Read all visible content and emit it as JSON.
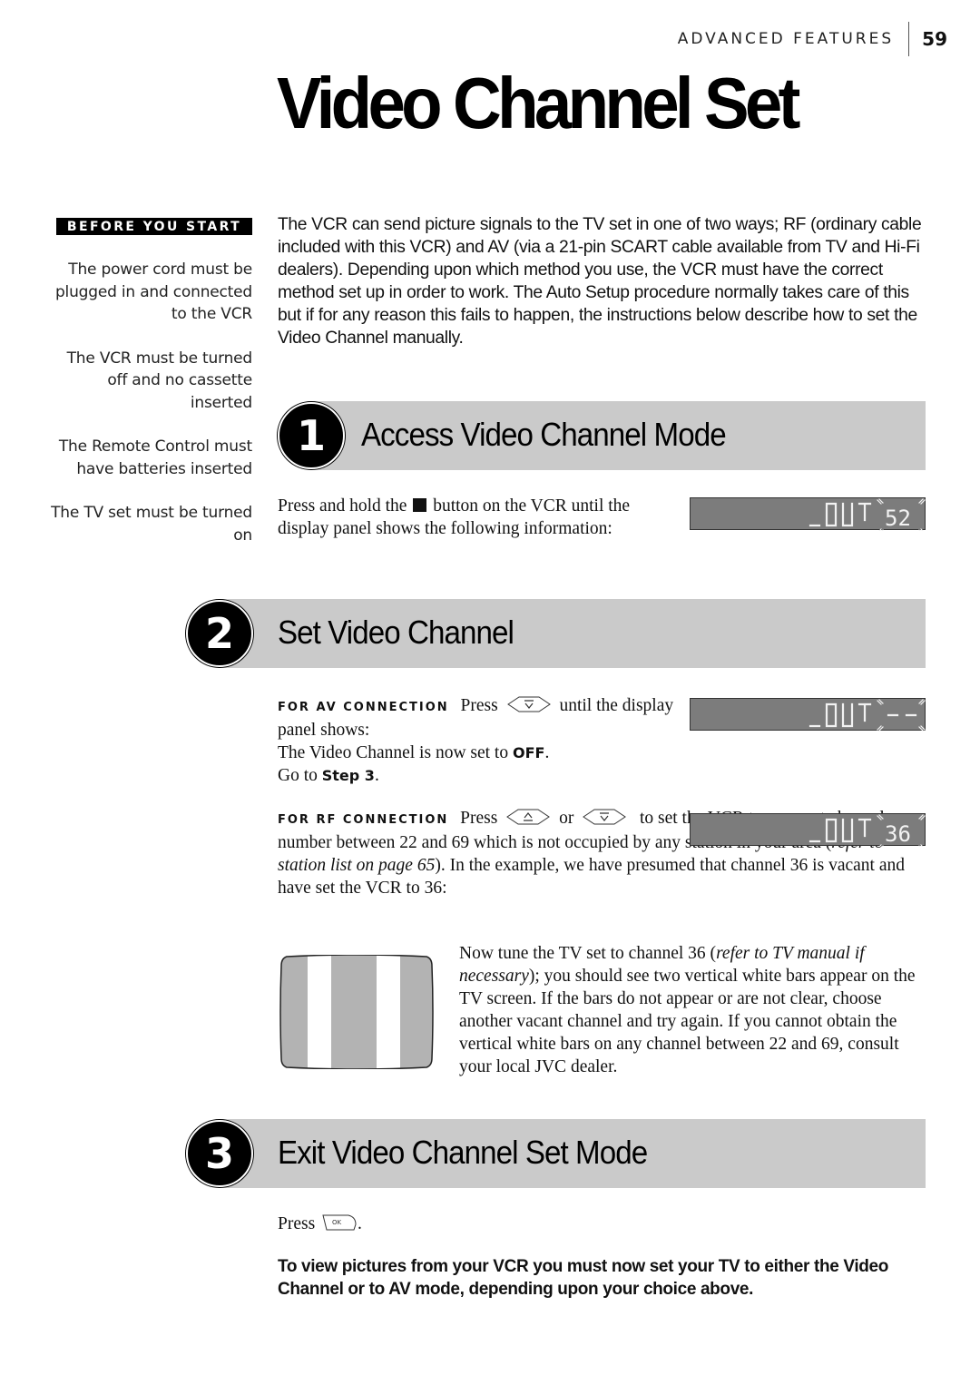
{
  "header": {
    "section": "ADVANCED FEATURES",
    "page_number": "59"
  },
  "title": "Video Channel Set",
  "sidebar": {
    "badge": "BEFORE YOU START",
    "items": [
      "The power cord must be plugged in and connected to the VCR",
      "The VCR must be turned off and no cassette inserted",
      "The Remote Control must have batteries inserted",
      "The TV set must be turned on"
    ]
  },
  "intro": "The VCR can send picture signals to the TV set in one of two ways; RF (ordinary cable included with this VCR) and AV (via a 21-pin SCART cable available from TV and Hi-Fi dealers). Depending upon which method you use, the VCR must have the correct method set up in order to work. The Auto Setup procedure normally takes care of this but if for any reason this fails to happen, the instructions below describe how to set the Video Channel manually.",
  "steps": [
    {
      "number": "1",
      "title": "Access Video Channel Mode",
      "text_a": "Press and hold the",
      "button_icon": "stop-button-icon",
      "text_b": "button on the VCR until the display panel shows the following information:",
      "display": {
        "label": "_OUT",
        "channel": "52"
      }
    },
    {
      "number": "2",
      "title": "Set Video Channel",
      "av": {
        "label": "FOR AV CONNECTION",
        "press": "Press",
        "button_icon": "channel-down-button-icon",
        "text_a": "until the display panel shows:",
        "text_b": "The Video Channel is now set to",
        "off": "OFF",
        "text_c": "Go to",
        "step_ref": "Step 3",
        "period": ".",
        "display": {
          "label": "_OUT",
          "channel": "--"
        }
      },
      "rf": {
        "label": "FOR RF CONNECTION",
        "press": "Press",
        "up_icon": "channel-up-button-icon",
        "or": "or",
        "down_icon": "channel-down-button-icon",
        "text_a": "to set the VCR to a vacant channel number between 22 and 69 which is not occupied by any station in your area (",
        "ref": "refer to station list on page 65",
        "text_b": "). In the example, we have presumed that channel 36 is vacant and have set the VCR to 36:",
        "display": {
          "label": "_OUT",
          "channel": "36"
        }
      },
      "tv": {
        "text_a": "Now tune the TV set to channel 36 (",
        "ref": "refer to TV manual if necessary",
        "text_b": "); you should see two vertical white bars appear on the TV screen. If the bars do not appear or are not clear, choose another vacant channel and try again. If you cannot obtain the vertical white bars on any channel between 22 and 69, consult your local JVC dealer."
      }
    },
    {
      "number": "3",
      "title": "Exit Video Channel Set Mode",
      "press": "Press",
      "button_icon": "ok-button-icon",
      "period": "."
    }
  ],
  "final_note": "To view pictures from your VCR you must now set your TV to either the Video Channel or to AV mode, depending upon your choice above.",
  "colors": {
    "step_bar": "#cacaca",
    "lcd_bg": "#7c7c7c",
    "tv_screen": "#b3b3b3"
  }
}
